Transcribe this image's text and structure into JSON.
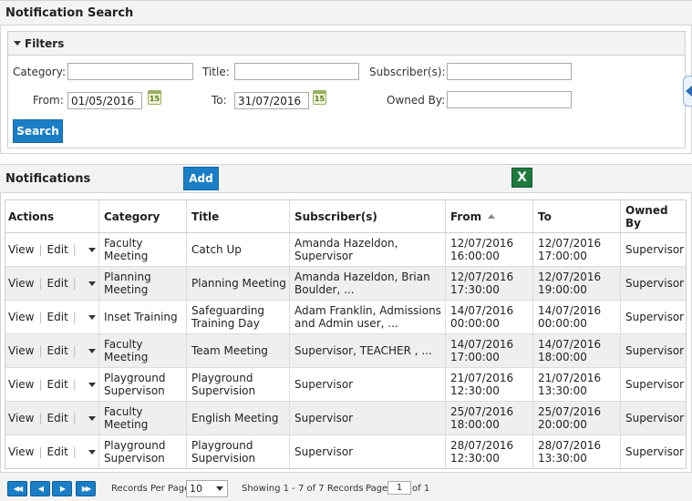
{
  "search_panel": {
    "title": "Notification Search"
  },
  "filters": {
    "legend": "Filters",
    "category": {
      "label": "Category:",
      "value": ""
    },
    "title": {
      "label": "Title:",
      "value": ""
    },
    "subscribers": {
      "label": "Subscriber(s):",
      "value": ""
    },
    "from": {
      "label": "From:",
      "value": "01/05/2016"
    },
    "to": {
      "label": "To:",
      "value": "31/07/2016"
    },
    "owned_by": {
      "label": "Owned By:",
      "value": ""
    },
    "calendar_icon_text": "15",
    "search_button": "Search"
  },
  "notifications_panel": {
    "title": "Notifications",
    "add_button": "Add",
    "excel_icon": "excel-icon"
  },
  "grid": {
    "columns": [
      "Actions",
      "Category",
      "Title",
      "Subscriber(s)",
      "From",
      "To",
      "Owned By"
    ],
    "sorted_column": "From",
    "action_labels": {
      "view": "View",
      "edit": "Edit",
      "sep": "|"
    },
    "rows": [
      {
        "category": "Faculty Meeting",
        "title": "Catch Up",
        "subscribers": "Amanda Hazeldon, Supervisor",
        "from": "12/07/2016 16:00:00",
        "to": "12/07/2016 17:00:00",
        "owned_by": "Supervisor"
      },
      {
        "category": "Planning Meeting",
        "title": "Planning Meeting",
        "subscribers": "Amanda Hazeldon, Brian Boulder, ...",
        "from": "12/07/2016 17:30:00",
        "to": "12/07/2016 19:00:00",
        "owned_by": "Supervisor"
      },
      {
        "category": "Inset Training",
        "title": "Safeguarding Training Day",
        "subscribers": "Adam Franklin, Admissions and Admin user, ...",
        "from": "14/07/2016 00:00:00",
        "to": "14/07/2016 00:00:00",
        "owned_by": "Supervisor"
      },
      {
        "category": "Faculty Meeting",
        "title": "Team Meeting",
        "subscribers": "Supervisor, TEACHER , ...",
        "from": "14/07/2016 17:00:00",
        "to": "14/07/2016 18:00:00",
        "owned_by": "Supervisor"
      },
      {
        "category": "Playground Supervison",
        "title": "Playground Supervision",
        "subscribers": "Supervisor",
        "from": "21/07/2016 12:30:00",
        "to": "21/07/2016 13:30:00",
        "owned_by": "Supervisor"
      },
      {
        "category": "Faculty Meeting",
        "title": "English Meeting",
        "subscribers": "Supervisor",
        "from": "25/07/2016 18:00:00",
        "to": "25/07/2016 20:00:00",
        "owned_by": "Supervisor"
      },
      {
        "category": "Playground Supervison",
        "title": "Playground Supervision",
        "subscribers": "Supervisor",
        "from": "28/07/2016 12:30:00",
        "to": "28/07/2016 13:30:00",
        "owned_by": "Supervisor"
      }
    ]
  },
  "pager": {
    "records_per_page_label": "Records Per Page",
    "records_per_page_value": "10",
    "showing_text": "Showing 1 - 7 of 7 Records",
    "page_label": "Page",
    "page_value": "1",
    "of_text": "of 1"
  }
}
